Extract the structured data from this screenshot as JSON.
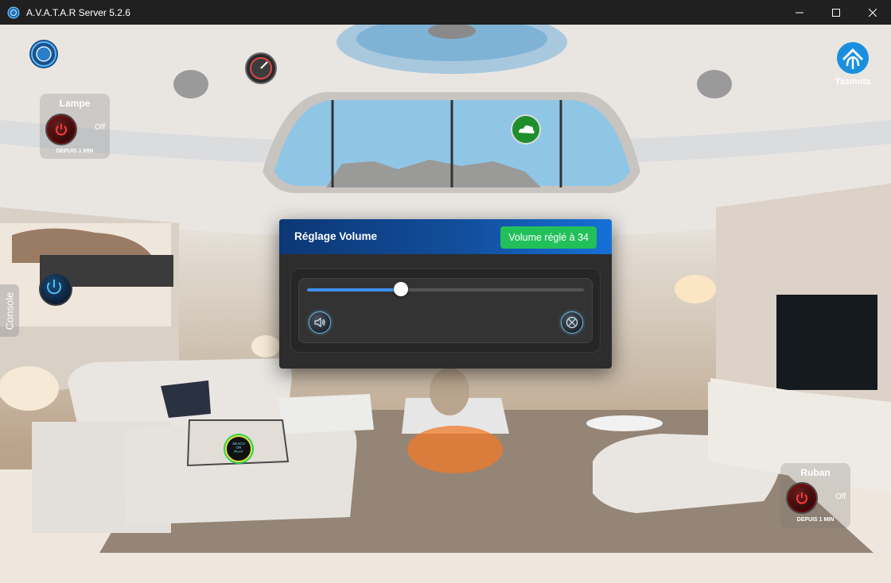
{
  "window": {
    "title": "A.V.A.T.A.R Server 5.2.6"
  },
  "widgets": {
    "lampe": {
      "label": "Lampe",
      "status": "Off",
      "since": "DEPUIS 1 MIN"
    },
    "ruban": {
      "label": "Ruban",
      "status": "Off",
      "since": "DEPUIS 1 MIN"
    },
    "tasmota": {
      "label": "Tasmota"
    },
    "console": {
      "label": "Console"
    },
    "sticker": {
      "text": "SEACH\nOR\nPLAY"
    }
  },
  "volume_dialog": {
    "title": "Réglage Volume",
    "badge": "Volume réglé à 34",
    "volume_percent": 34
  },
  "colors": {
    "header_start": "#0c3775",
    "header_end": "#1571d7",
    "badge": "#22c05a",
    "slider_fill": "#3f8ef0"
  }
}
